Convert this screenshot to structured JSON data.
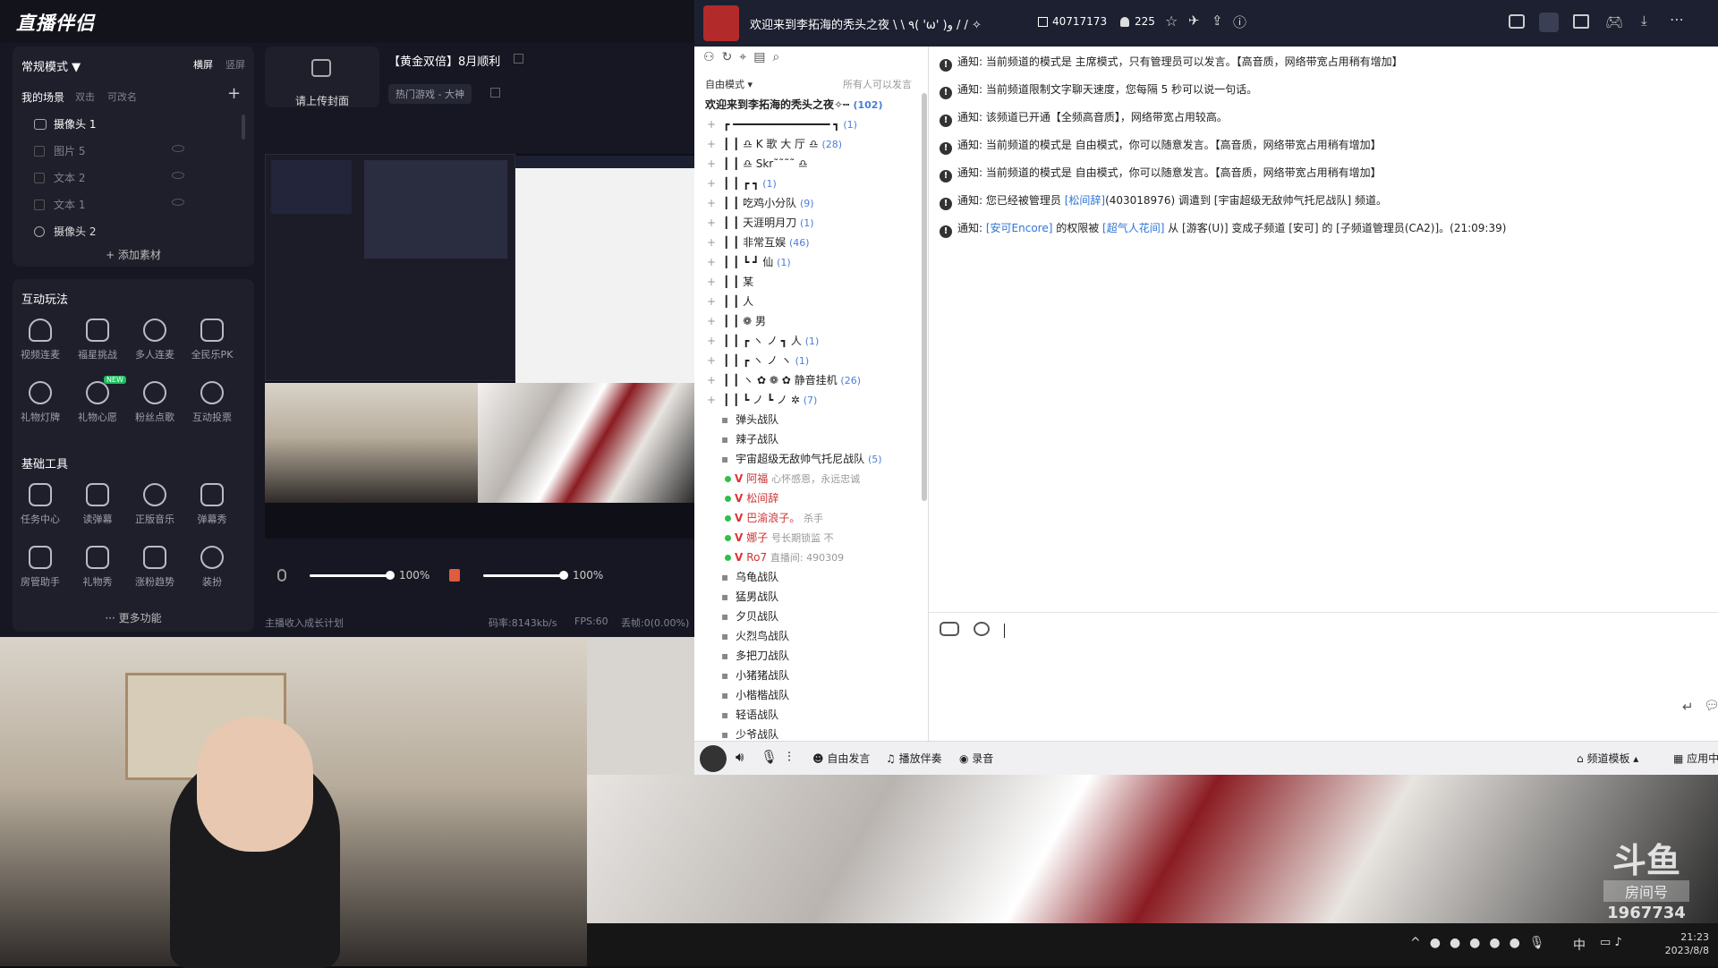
{
  "app": {
    "logo": "直播伴侣"
  },
  "scenes": {
    "mode": "常规模式 ▼",
    "orientation": [
      "横屏",
      "竖屏"
    ],
    "tabs": [
      "我的场景",
      "双击",
      "可改名"
    ],
    "add": "+",
    "items": [
      "摄像头 1",
      "图片 5",
      "文本 2",
      "文本 1",
      "摄像头 2"
    ],
    "add_source": "+ 添加素材"
  },
  "stream": {
    "cover": "请上传封面",
    "title": "【黄金双倍】8月顺利",
    "category": "热门游戏 - 大神"
  },
  "interactive": {
    "heading": "互动玩法",
    "tools": [
      "视频连麦",
      "福星挑战",
      "多人连麦",
      "全民乐PK",
      "礼物灯牌",
      "礼物心愿",
      "粉丝点歌",
      "互动投票"
    ],
    "new_badge": "NEW"
  },
  "basic": {
    "heading": "基础工具",
    "tools": [
      "任务中心",
      "读弹幕",
      "正版音乐",
      "弹幕秀",
      "房管助手",
      "礼物秀",
      "涨粉趋势",
      "装扮"
    ],
    "more": "··· 更多功能"
  },
  "audio": {
    "mic_level": "100%",
    "speaker_level": "100%",
    "mic_fill": 1.0,
    "speaker_fill": 1.0
  },
  "status": {
    "plan": "主播收入成长计划",
    "bitrate": "码率:8143kb/s",
    "fps": "FPS:60",
    "dropped": "丢帧:0(0.00%)"
  },
  "yy": {
    "title": "欢迎来到李拓海的秃头之夜 \\ \\ ٩( 'ω' )و / / ✧",
    "channel_id": "40717173",
    "users": "225",
    "mode": "自由模式",
    "mode_caret": "▾",
    "speak_rule": "所有人可以发言",
    "root_name": "欢迎来到李拓海的秃头之夜✧┅",
    "root_count": "(102)",
    "tree": [
      {
        "text": "┏ ━━━━━━━━━━━━━━━ ┓",
        "count": "(1)"
      },
      {
        "text": "┃ ┃    ♎  K  歌 大 厅 ♎",
        "count": "(28)"
      },
      {
        "text": "┃ ┃    ♎  Skr˜˜˜˜    ♎",
        "count": ""
      },
      {
        "text": "┃ ┃  ┏          ┓",
        "count": "(1)"
      },
      {
        "text": "┃ ┃    吃鸡小分队",
        "count": "(9)"
      },
      {
        "text": "┃ ┃    天涯明月刀",
        "count": "(1)"
      },
      {
        "text": "┃ ┃    非常互娱",
        "count": "(46)"
      },
      {
        "text": "┃ ┃  ┗          ┛           仙",
        "count": "(1)"
      },
      {
        "text": "┃ ┃                             某",
        "count": ""
      },
      {
        "text": "┃ ┃                             人",
        "count": ""
      },
      {
        "text": "┃ ┃          ❁                  男",
        "count": ""
      },
      {
        "text": "┃ ┃     ┏ ヽ ノ ┓               人",
        "count": "(1)"
      },
      {
        "text": "┃ ┃  ┏ ヽ    ノ ヽ",
        "count": "(1)"
      },
      {
        "text": "┃ ┃  ヽ ✿  ❁  ✿  静音挂机",
        "count": "(26)"
      },
      {
        "text": "┃ ┃    ┗ ノ  ┗ ノ        ✲",
        "count": "(7)"
      }
    ],
    "teams_a": [
      "弹头战队",
      "辣子战队"
    ],
    "cur_team": "宇宙超级无敌帅气托尼战队",
    "cur_team_count": "(5)",
    "members": [
      {
        "name": "阿福",
        "note": "心怀感恩，永远忠诚"
      },
      {
        "name": "松间辞",
        "note": ""
      },
      {
        "name": "巴渝浪子。",
        "note": "杀手"
      },
      {
        "name": "娜子",
        "note": "号长期锁监 不"
      },
      {
        "name": "Ro7",
        "note": "直播间: 490309"
      }
    ],
    "teams_b": [
      "乌龟战队",
      "猛男战队",
      "夕贝战队",
      "火烈鸟战队",
      "多把刀战队",
      "小猪猪战队",
      "小楷楷战队",
      "轻语战队",
      "少爷战队"
    ],
    "notices": [
      "通知:  当前频道的模式是 主席模式，只有管理员可以发言。【高音质，网络带宽占用稍有增加】",
      "通知:  当前频道限制文字聊天速度，您每隔 5 秒可以说一句话。",
      "通知:  该频道已开通【全频高音质】，网络带宽占用较高。",
      "通知:  当前频道的模式是 自由模式，你可以随意发言。【高音质，网络带宽占用稍有增加】",
      "通知:  当前频道的模式是 自由模式，你可以随意发言。【高音质，网络带宽占用稍有增加】"
    ],
    "notice6": {
      "pre": "通知:  您已经被管理员 ",
      "who": "[松间辞]",
      "post": "(403018976) 调遣到 [宇宙超级无敌帅气托尼战队] 频道。"
    },
    "notice7": {
      "pre": "通知:  ",
      "a": "[安可Encore]",
      "mid": " 的权限被 ",
      "b": "[超气人花间]",
      "post": " 从 [游客(U)] 变成子频道 [安可] 的 [子频道管理员(CA2)]。(21:09:39)"
    },
    "footer": {
      "free_speak": "自由发言",
      "music": "播放伴奏",
      "record": "录音",
      "template": "频道模板 ▴",
      "apps": "应用中"
    }
  },
  "watermark": {
    "brand": "斗鱼",
    "label": "房间号",
    "room": "1967734"
  },
  "taskbar": {
    "ime": "中",
    "time": "21:23",
    "date": "2023/8/8"
  },
  "colors": {
    "accent": "#4a7ed8",
    "panel": "#1e1f2b",
    "yy_bar": "#1c2030"
  }
}
